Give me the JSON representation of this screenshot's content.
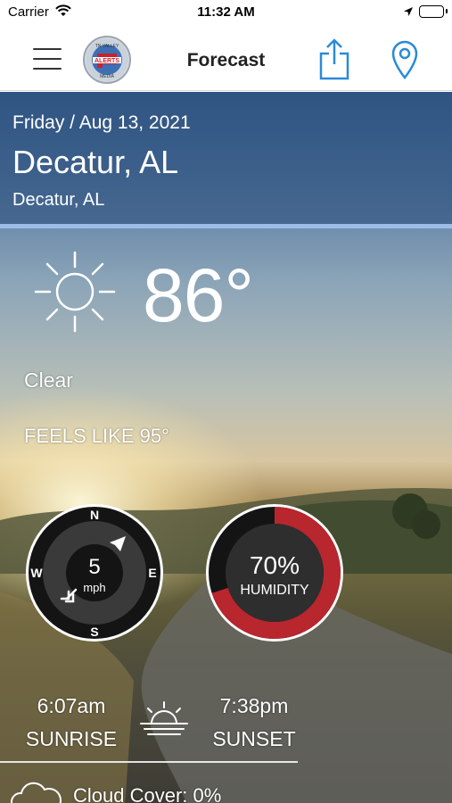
{
  "status_bar": {
    "carrier": "Carrier",
    "time": "11:32 AM"
  },
  "nav": {
    "title": "Forecast",
    "logo_text_top": "TN VALLEY",
    "logo_text_main": "ALERTS",
    "logo_text_bottom": "MEDIA",
    "accent_color": "#2a8ad8"
  },
  "location": {
    "date": "Friday / Aug 13, 2021",
    "city": "Decatur, AL",
    "subtitle": "Decatur, AL"
  },
  "current": {
    "icon": "sun-icon",
    "temperature": "86°",
    "condition": "Clear",
    "feels_like": "FEELS LIKE 95°"
  },
  "wind": {
    "speed": "5",
    "unit": "mph",
    "compass": {
      "n": "N",
      "e": "E",
      "s": "S",
      "w": "W"
    }
  },
  "humidity": {
    "value": "70%",
    "label": "HUMIDITY",
    "fraction": 0.7,
    "ring_color": "#b8262e"
  },
  "sun": {
    "sunrise_time": "6:07am",
    "sunrise_label": "SUNRISE",
    "sunset_time": "7:38pm",
    "sunset_label": "SUNSET"
  },
  "cloud_cover": {
    "label": "Cloud Cover: 0%"
  }
}
